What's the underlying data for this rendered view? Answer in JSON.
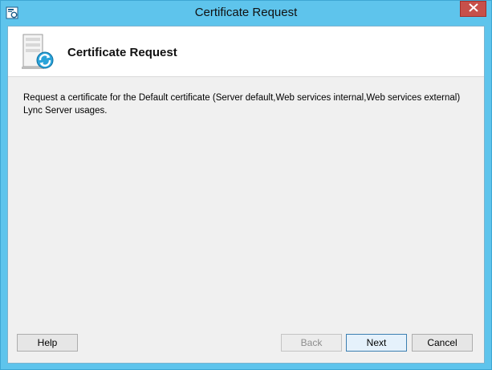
{
  "window": {
    "title": "Certificate Request"
  },
  "header": {
    "title": "Certificate Request"
  },
  "body": {
    "description_line1": "Request a certificate for the Default certificate (Server default,Web services internal,Web services external)",
    "description_line2": "Lync Server usages."
  },
  "buttons": {
    "help": "Help",
    "back": "Back",
    "next": "Next",
    "cancel": "Cancel"
  },
  "icons": {
    "title": "certificate-app-icon",
    "header": "server-refresh-icon",
    "close": "close-icon"
  },
  "colors": {
    "titlebar": "#5ec4ec",
    "close": "#c7504a",
    "dialog_bg": "#f0f0f0"
  }
}
